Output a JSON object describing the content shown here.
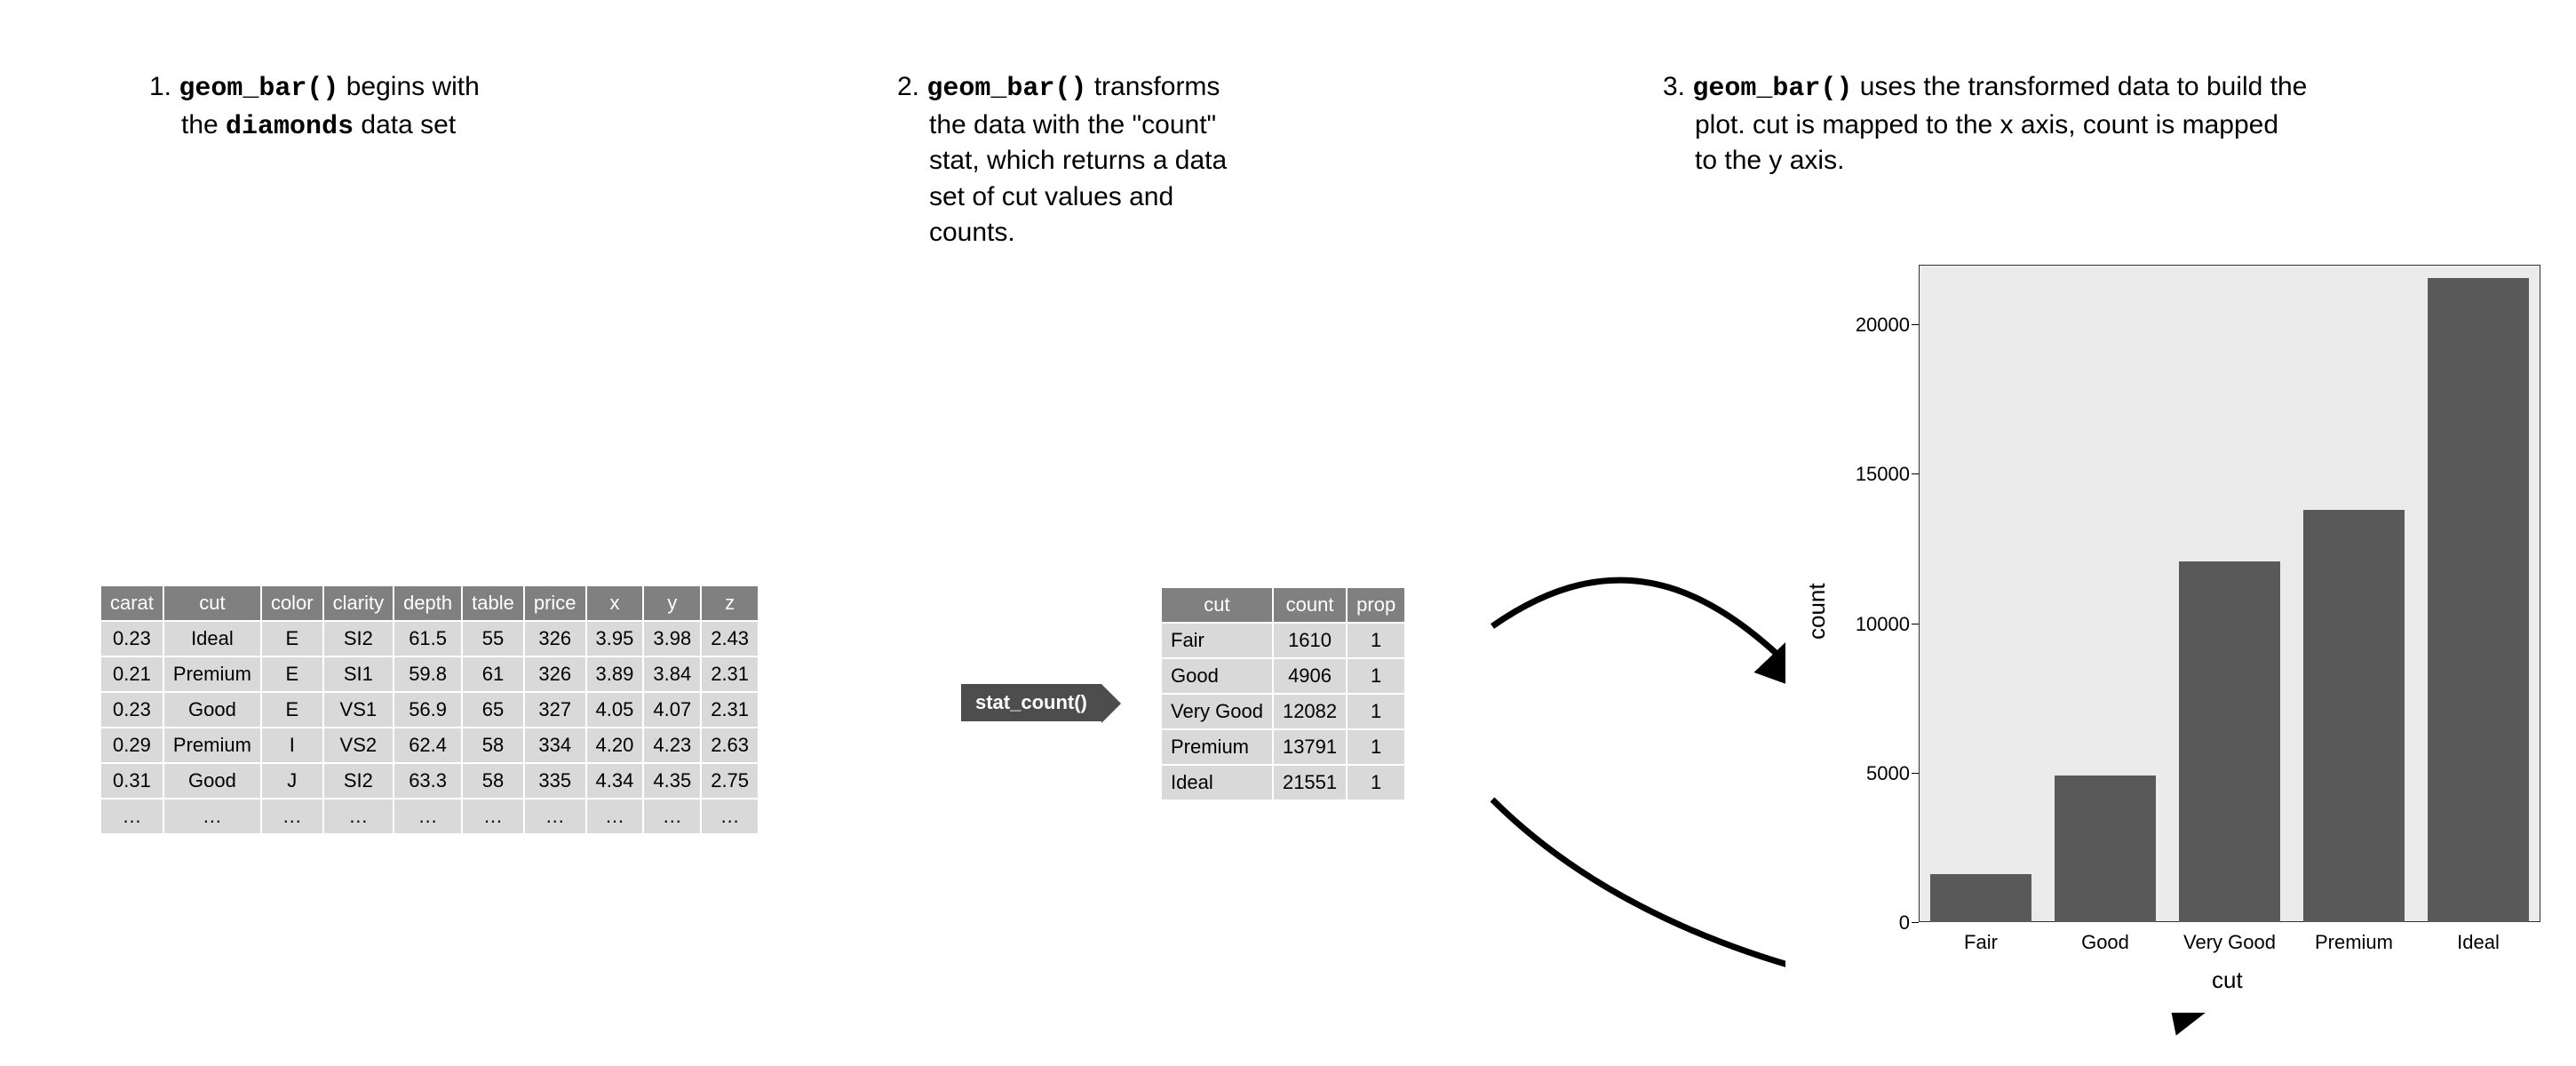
{
  "captions": {
    "step1_num": "1. ",
    "step1_a": "geom_bar()",
    "step1_b": " begins with",
    "step1_c": "the ",
    "step1_d": "diamonds",
    "step1_e": " data set",
    "step2_num": "2. ",
    "step2_a": "geom_bar()",
    "step2_b": " transforms",
    "step2_c": "the data with the \"count\"",
    "step2_d": "stat, which returns a data",
    "step2_e": "set of cut values and",
    "step2_f": "counts.",
    "step3_num": "3. ",
    "step3_a": "geom_bar()",
    "step3_b": " uses the transformed data to build the",
    "step3_c": "plot. cut is mapped to the x axis, count is mapped",
    "step3_d": "to the y axis."
  },
  "pill_label": "stat_count()",
  "table1": {
    "headers": [
      "carat",
      "cut",
      "color",
      "clarity",
      "depth",
      "table",
      "price",
      "x",
      "y",
      "z"
    ],
    "rows": [
      [
        "0.23",
        "Ideal",
        "E",
        "SI2",
        "61.5",
        "55",
        "326",
        "3.95",
        "3.98",
        "2.43"
      ],
      [
        "0.21",
        "Premium",
        "E",
        "SI1",
        "59.8",
        "61",
        "326",
        "3.89",
        "3.84",
        "2.31"
      ],
      [
        "0.23",
        "Good",
        "E",
        "VS1",
        "56.9",
        "65",
        "327",
        "4.05",
        "4.07",
        "2.31"
      ],
      [
        "0.29",
        "Premium",
        "I",
        "VS2",
        "62.4",
        "58",
        "334",
        "4.20",
        "4.23",
        "2.63"
      ],
      [
        "0.31",
        "Good",
        "J",
        "SI2",
        "63.3",
        "58",
        "335",
        "4.34",
        "4.35",
        "2.75"
      ],
      [
        "…",
        "…",
        "…",
        "…",
        "…",
        "…",
        "…",
        "…",
        "…",
        "…"
      ]
    ]
  },
  "table2": {
    "headers": [
      "cut",
      "count",
      "prop"
    ],
    "rows": [
      [
        "Fair",
        "1610",
        "1"
      ],
      [
        "Good",
        "4906",
        "1"
      ],
      [
        "Very Good",
        "12082",
        "1"
      ],
      [
        "Premium",
        "13791",
        "1"
      ],
      [
        "Ideal",
        "21551",
        "1"
      ]
    ]
  },
  "chart_data": {
    "type": "bar",
    "categories": [
      "Fair",
      "Good",
      "Very Good",
      "Premium",
      "Ideal"
    ],
    "values": [
      1610,
      4906,
      12082,
      13791,
      21551
    ],
    "xlabel": "cut",
    "ylabel": "count",
    "ylim": [
      0,
      22000
    ],
    "yticks": [
      0,
      5000,
      10000,
      15000,
      20000
    ],
    "ytick_labels": [
      "0",
      "5000",
      "10000",
      "15000",
      "20000"
    ]
  }
}
